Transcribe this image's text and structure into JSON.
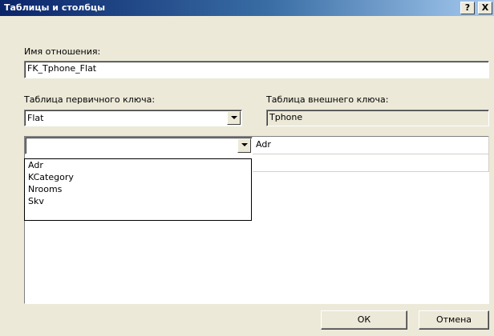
{
  "window": {
    "title": "Таблицы и столбцы",
    "help_label": "?",
    "close_label": "X"
  },
  "relation": {
    "label": "Имя отношения:",
    "value": "FK_Tphone_Flat"
  },
  "primary_table": {
    "label": "Таблица первичного ключа:",
    "value": "Flat"
  },
  "foreign_table": {
    "label": "Таблица внешнего ключа:",
    "value": "Tphone"
  },
  "mapping": {
    "primary_column": "",
    "foreign_column": "Adr"
  },
  "dropdown": {
    "options": [
      "Adr",
      "KCategory",
      "Nrooms",
      "Skv"
    ]
  },
  "buttons": {
    "ok": "ОК",
    "cancel": "Отмена"
  }
}
